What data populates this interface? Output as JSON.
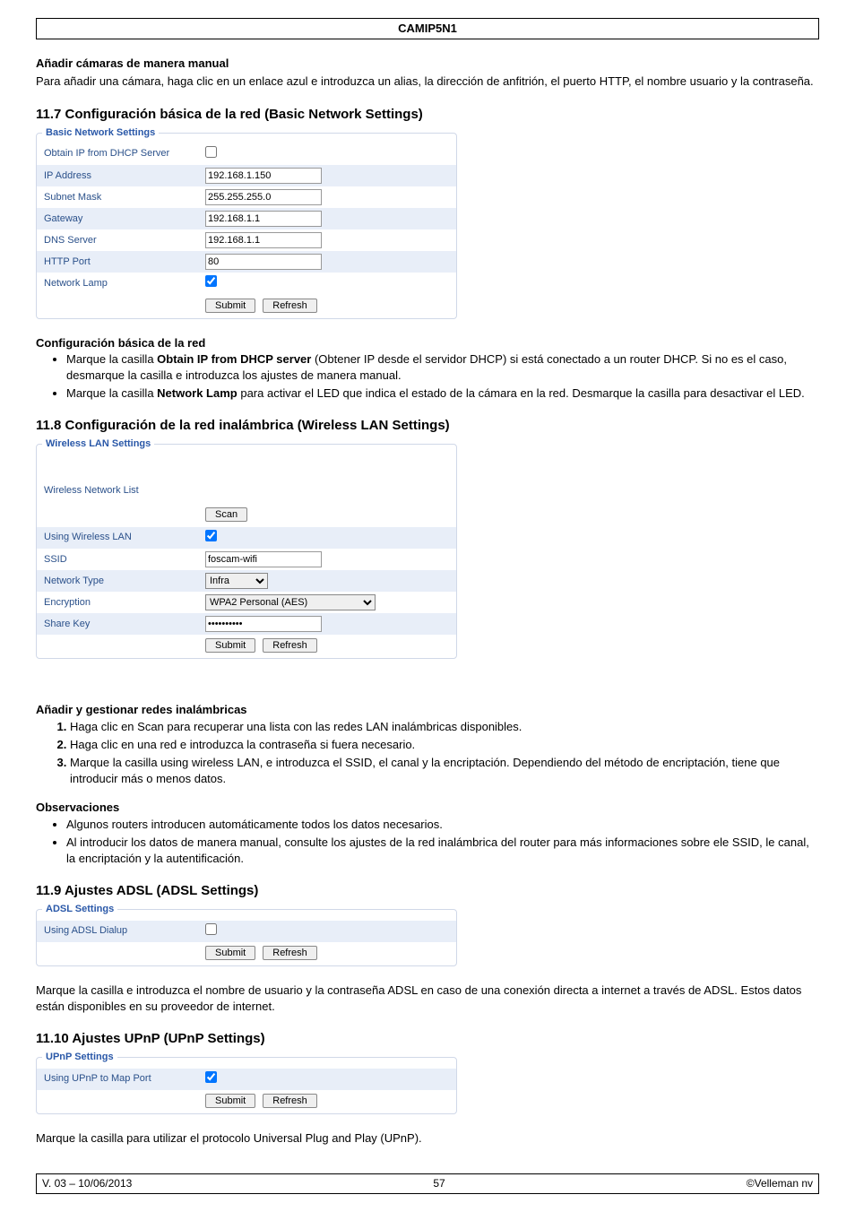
{
  "header": {
    "title": "CAMIP5N1"
  },
  "s_manual": {
    "title": "Añadir cámaras de manera manual",
    "body": "Para añadir una cámara, haga clic en un enlace azul e introduzca un alias, la dirección de anfitrión, el puerto HTTP, el nombre usuario y la contraseña."
  },
  "s117": {
    "heading": "11.7   Configuración básica de la red (Basic Network Settings)",
    "panel": {
      "legend": "Basic Network Settings",
      "rows": {
        "dhcp": "Obtain IP from DHCP Server",
        "ip": {
          "lbl": "IP Address",
          "val": "192.168.1.150"
        },
        "mask": {
          "lbl": "Subnet Mask",
          "val": "255.255.255.0"
        },
        "gw": {
          "lbl": "Gateway",
          "val": "192.168.1.1"
        },
        "dns": {
          "lbl": "DNS Server",
          "val": "192.168.1.1"
        },
        "http": {
          "lbl": "HTTP Port",
          "val": "80"
        },
        "lamp": "Network Lamp"
      },
      "submit": "Submit",
      "refresh": "Refresh"
    },
    "conf_title": "Configuración básica de la red",
    "b1a": "Marque la casilla ",
    "b1b": "Obtain IP from DHCP server",
    "b1c": " (Obtener IP desde el servidor DHCP) si está conectado a un router DHCP. Si no es el caso, desmarque la casilla e introduzca los ajustes de manera manual.",
    "b2a": "Marque la casilla ",
    "b2b": "Network Lamp",
    "b2c": " para activar el LED que indica el estado de la cámara en la red. Desmarque la casilla para desactivar el LED."
  },
  "s118": {
    "heading": "11.8   Configuración de la red inalámbrica (Wireless LAN Settings)",
    "panel": {
      "legend": "Wireless LAN Settings",
      "rows": {
        "list": "Wireless Network List",
        "scan": "Scan",
        "uselan": "Using Wireless LAN",
        "ssid": {
          "lbl": "SSID",
          "val": "foscam-wifi"
        },
        "nettype": {
          "lbl": "Network Type",
          "val": "Infra"
        },
        "enc": {
          "lbl": "Encryption",
          "val": "WPA2 Personal (AES)"
        },
        "key": {
          "lbl": "Share Key",
          "val": "••••••••••"
        }
      },
      "submit": "Submit",
      "refresh": "Refresh"
    },
    "add_title": "Añadir y gestionar redes inalámbricas",
    "n1a": "Haga clic en ",
    "n1b": "Scan",
    "n1c": " para recuperar una lista con las redes LAN inalámbricas disponibles.",
    "n2": "Haga clic en una red e introduzca la contraseña si fuera necesario.",
    "n3a": "Marque la casilla ",
    "n3b": "using wireless LAN",
    "n3c": ", e introduzca el SSID, el canal y la encriptación. Dependiendo del método de encriptación, tiene que introducir más o menos datos.",
    "obs_title": "Observaciones",
    "o1": "Algunos routers introducen automáticamente todos los datos necesarios.",
    "o2": "Al introducir los datos de manera manual, consulte los ajustes de la red inalámbrica del router para más informaciones sobre ele SSID, le canal, la encriptación y la autentificación."
  },
  "s119": {
    "heading": "11.9   Ajustes ADSL (ADSL Settings)",
    "panel": {
      "legend": "ADSL Settings",
      "row": "Using ADSL Dialup",
      "submit": "Submit",
      "refresh": "Refresh"
    },
    "body": "Marque la casilla e introduzca el nombre de usuario y la contraseña ADSL en caso de una conexión directa a internet a través de ADSL. Estos datos están disponibles en su proveedor de internet."
  },
  "s1110": {
    "heading": "11.10 Ajustes UPnP (UPnP Settings)",
    "panel": {
      "legend": "UPnP Settings",
      "row": "Using UPnP to Map Port",
      "submit": "Submit",
      "refresh": "Refresh"
    },
    "body": "Marque la casilla para utilizar el protocolo Universal Plug and Play (UPnP)."
  },
  "footer": {
    "left": "V. 03 – 10/06/2013",
    "center": "57",
    "right": "©Velleman nv"
  }
}
